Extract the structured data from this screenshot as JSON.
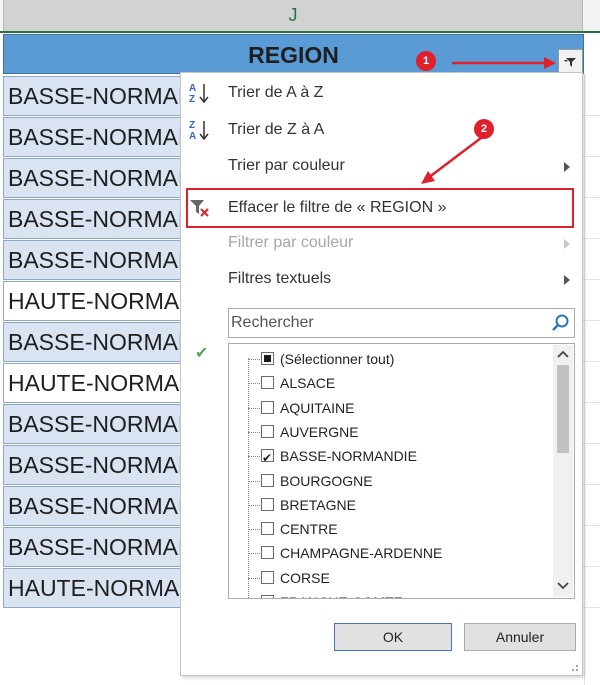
{
  "column_header": {
    "label": "J"
  },
  "header_cell": {
    "label": "REGION"
  },
  "rows": [
    {
      "text": "BASSE-NORMANDIE",
      "style": "b"
    },
    {
      "text": "BASSE-NORMANDIE",
      "style": "b"
    },
    {
      "text": "BASSE-NORMANDIE",
      "style": "b"
    },
    {
      "text": "BASSE-NORMANDIE",
      "style": "b"
    },
    {
      "text": "BASSE-NORMANDIE",
      "style": "b"
    },
    {
      "text": "HAUTE-NORMANDIE",
      "style": "w"
    },
    {
      "text": "BASSE-NORMANDIE",
      "style": "b"
    },
    {
      "text": "HAUTE-NORMANDIE",
      "style": "w"
    },
    {
      "text": "BASSE-NORMANDIE",
      "style": "b"
    },
    {
      "text": "BASSE-NORMANDIE",
      "style": "b"
    },
    {
      "text": "BASSE-NORMANDIE",
      "style": "b"
    },
    {
      "text": "BASSE-NORMANDIE",
      "style": "b"
    },
    {
      "text": "HAUTE-NORMANDIE",
      "style": "b"
    }
  ],
  "menu": {
    "sort_az": "Trier de A à Z",
    "sort_za": "Trier de Z à A",
    "sort_color": "Trier par couleur",
    "clear_filter": "Effacer le filtre de « REGION »",
    "filter_color": "Filtrer par couleur",
    "text_filters": "Filtres textuels",
    "search_placeholder": "Rechercher",
    "items": [
      {
        "label": "(Sélectionner tout)",
        "state": "ind"
      },
      {
        "label": "ALSACE",
        "state": "off"
      },
      {
        "label": "AQUITAINE",
        "state": "off"
      },
      {
        "label": "AUVERGNE",
        "state": "off"
      },
      {
        "label": "BASSE-NORMANDIE",
        "state": "chk"
      },
      {
        "label": "BOURGOGNE",
        "state": "off"
      },
      {
        "label": "BRETAGNE",
        "state": "off"
      },
      {
        "label": "CENTRE",
        "state": "off"
      },
      {
        "label": "CHAMPAGNE-ARDENNE",
        "state": "off"
      },
      {
        "label": "CORSE",
        "state": "off"
      },
      {
        "label": "FRANCHE-COMTE",
        "state": "off"
      }
    ],
    "ok_label": "OK",
    "cancel_label": "Annuler"
  },
  "annotations": {
    "badge1": "1",
    "badge2": "2",
    "color": "#e0202a"
  },
  "colors": {
    "header_fill": "#5b9bd5",
    "row_fill": "#d9e3f1",
    "excel_green": "#217346"
  }
}
